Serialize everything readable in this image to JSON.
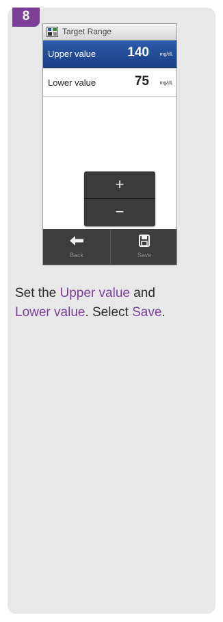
{
  "step": {
    "number": "8"
  },
  "screen": {
    "title": "Target Range",
    "title_icon": "target-range-icon",
    "rows": [
      {
        "label": "Upper value",
        "value": "140",
        "unit": "mg/dL",
        "selected": true
      },
      {
        "label": "Lower value",
        "value": "75",
        "unit": "mg/dL",
        "selected": false
      }
    ],
    "stepper": {
      "plus": "+",
      "minus": "−"
    },
    "buttons": {
      "back": {
        "label": "Back",
        "icon": "arrow-left-icon"
      },
      "save": {
        "label": "Save",
        "icon": "floppy-disk-icon"
      }
    }
  },
  "instruction": {
    "part1": "Set the ",
    "link1": "Upper value",
    "part2": " and ",
    "link2": "Lower value",
    "part3": ". Select ",
    "link3": "Save",
    "part4": "."
  },
  "colors": {
    "accent": "#7b3f97",
    "selected_row": "#1f4a96",
    "card_bg": "#e8e8e9",
    "bottom_bar": "#3d3d3d"
  }
}
